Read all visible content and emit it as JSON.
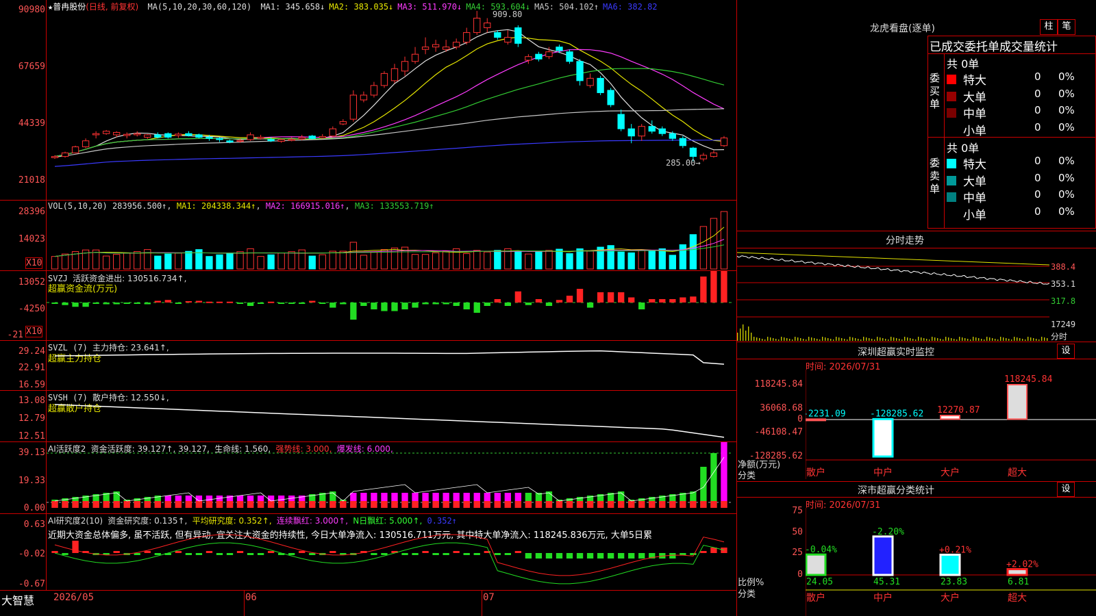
{
  "stock": {
    "star": "★",
    "name": "普冉股份",
    "mode": "(日线, 前复权)"
  },
  "price_ma": {
    "label": "MA(5,10,20,30,60,120)",
    "items": [
      {
        "text": "MA1: 345.658↓",
        "color": "#e0e0e0"
      },
      {
        "text": "MA2: 383.035↓",
        "color": "#e6e600"
      },
      {
        "text": "MA3: 511.970↓",
        "color": "#ff3cff"
      },
      {
        "text": "MA4: 593.604↓",
        "color": "#33cc33"
      },
      {
        "text": "MA5: 504.102↑",
        "color": "#c8c8c8"
      },
      {
        "text": "MA6: 382.82",
        "color": "#3a3aff"
      }
    ],
    "high_mark": "909.80",
    "low_mark": "285.00→"
  },
  "price_axis": [
    "90980",
    "67659",
    "44339",
    "21018"
  ],
  "vol": {
    "label": "VOL(5,10,20)",
    "value": "283956.500↑",
    "ma1": "MA1: 204338.344↑",
    "ma2": "MA2: 166915.016↑",
    "ma3": "MA3: 133553.719↑",
    "axis": [
      "28396",
      "14023"
    ],
    "unit": "X10"
  },
  "svzj": {
    "label": "SVZJ",
    "desc": "活跃资金进出: 130516.734↑,",
    "sub": "超赢资金流(万元)",
    "axis": [
      "13052",
      "-4250",
      "-21"
    ],
    "unit": "X10"
  },
  "svzl": {
    "label": "SVZL (7)",
    "desc": "主力持仓: 23.641↑,",
    "sub": "超赢主力持仓",
    "axis": [
      "29.24",
      "22.91",
      "16.59"
    ]
  },
  "svsh": {
    "label": "SVSH (7)",
    "desc": "散户持仓: 12.550↓,",
    "sub": "超赢散户持仓",
    "axis": [
      "13.08",
      "12.79",
      "12.51"
    ]
  },
  "ai1": {
    "label": "AI活跃度2",
    "desc": "资金活跃度: 39.127↑, 39.127,",
    "life": "生命线: 1.560,",
    "strong": "强势线: 3.000,",
    "burst": "爆发线: 6.000,",
    "axis": [
      "39.13",
      "19.33",
      "0.00"
    ]
  },
  "ai2": {
    "label": "AI研究度2(10)",
    "desc": "资金研究度: 0.135↑,",
    "avg": "平均研究度: 0.352↑,",
    "cont": "连续飘红: 3.000↑,",
    "nday": "N日飘红: 5.000↑,",
    "last": "0.352↑",
    "axis": [
      "0.63",
      "-0.02",
      "-0.67"
    ],
    "comment": "近期大资金总体偏多, 虽不活跃, 但有异动, 宜关注大资金的持续性, 今日大单净流入: 130516.711万元, 其中特大单净流入: 118245.836万元, 大单5日累"
  },
  "xaxis": {
    "brand": "大智慧",
    "d1": "2026/05",
    "d2": "06",
    "d3": "07"
  },
  "right": {
    "dragon_title": "龙虎看盘(逐单)",
    "btn_bar": "柱",
    "btn_pen": "笔",
    "stats_title": "已成交委托单成交量统计",
    "buy_label": "委买单",
    "sell_label": "委卖单",
    "total": "共 0单",
    "rows": [
      {
        "name": "特大",
        "val": "0",
        "pct": "0%",
        "buycolor": "#ff0000",
        "sellcolor": "#00ffff"
      },
      {
        "name": "大单",
        "val": "0",
        "pct": "0%",
        "buycolor": "#990000",
        "sellcolor": "#009999"
      },
      {
        "name": "中单",
        "val": "0",
        "pct": "0%",
        "buycolor": "#7a0000",
        "sellcolor": "#008080"
      },
      {
        "name": "小单",
        "val": "0",
        "pct": "0%",
        "buycolor": "#000000",
        "sellcolor": "#000000"
      }
    ],
    "minute_title": "分时走势",
    "minute_axis": [
      "388.4",
      "353.1",
      "317.8"
    ],
    "minute_vol": "17249",
    "minute_vol_unit": "分时",
    "sz_title": "深圳超赢实时监控",
    "set": "设",
    "sz_time": "时间: 2026/07/31",
    "sz_axis": [
      "118245.84",
      "36068.68",
      "0",
      "-46108.47",
      "-128285.62"
    ],
    "sz_ylabel": "净额(万元)",
    "sz_ylabel2": "分类",
    "sz_bars": [
      {
        "cat": "散户",
        "value": -2231.09,
        "label": "-2231.09"
      },
      {
        "cat": "中户",
        "value": -128285.62,
        "label": "-128285.62"
      },
      {
        "cat": "大户",
        "value": 12270.87,
        "label": "12270.87"
      },
      {
        "cat": "超大",
        "value": 118245.84,
        "label": "118245.84"
      }
    ],
    "ss_title": "深市超赢分类统计",
    "ss_time": "时间: 2026/07/31",
    "ss_axis": [
      "75",
      "50",
      "25",
      "0"
    ],
    "ss_ylabel": "比例%",
    "ss_ylabel2": "分类",
    "ss_bars": [
      {
        "cat": "散户",
        "value": 24.05,
        "change": "-0.04%"
      },
      {
        "cat": "中户",
        "value": 45.31,
        "change": "-2.20%"
      },
      {
        "cat": "大户",
        "value": 23.83,
        "change": "+0.21%"
      },
      {
        "cat": "超大",
        "value": 6.81,
        "change": "+2.02%"
      }
    ]
  },
  "chart_data": {
    "type": "candlestick",
    "title": "普冉股份",
    "candles": [
      {
        "o": 300,
        "c": 305,
        "h": 310,
        "l": 295
      },
      {
        "o": 305,
        "c": 320,
        "h": 325,
        "l": 300
      },
      {
        "o": 320,
        "c": 345,
        "h": 350,
        "l": 318
      },
      {
        "o": 345,
        "c": 370,
        "h": 380,
        "l": 340
      },
      {
        "o": 395,
        "c": 400,
        "h": 410,
        "l": 380
      },
      {
        "o": 400,
        "c": 410,
        "h": 415,
        "l": 395
      },
      {
        "o": 395,
        "c": 405,
        "h": 410,
        "l": 385
      },
      {
        "o": 392,
        "c": 397,
        "h": 405,
        "l": 380
      },
      {
        "o": 395,
        "c": 400,
        "h": 410,
        "l": 388
      },
      {
        "o": 385,
        "c": 395,
        "h": 398,
        "l": 378
      },
      {
        "o": 395,
        "c": 385,
        "h": 405,
        "l": 380
      },
      {
        "o": 400,
        "c": 385,
        "h": 405,
        "l": 380
      },
      {
        "o": 392,
        "c": 398,
        "h": 405,
        "l": 382
      },
      {
        "o": 400,
        "c": 392,
        "h": 410,
        "l": 388
      },
      {
        "o": 395,
        "c": 385,
        "h": 400,
        "l": 380
      },
      {
        "o": 385,
        "c": 380,
        "h": 395,
        "l": 370
      },
      {
        "o": 380,
        "c": 375,
        "h": 385,
        "l": 365
      },
      {
        "o": 370,
        "c": 365,
        "h": 375,
        "l": 360
      },
      {
        "o": 368,
        "c": 372,
        "h": 380,
        "l": 362
      },
      {
        "o": 375,
        "c": 395,
        "h": 405,
        "l": 370
      },
      {
        "o": 380,
        "c": 385,
        "h": 395,
        "l": 375
      },
      {
        "o": 375,
        "c": 370,
        "h": 385,
        "l": 365
      },
      {
        "o": 368,
        "c": 375,
        "h": 380,
        "l": 362
      },
      {
        "o": 372,
        "c": 376,
        "h": 385,
        "l": 368
      },
      {
        "o": 378,
        "c": 384,
        "h": 395,
        "l": 372
      },
      {
        "o": 390,
        "c": 380,
        "h": 395,
        "l": 375
      },
      {
        "o": 382,
        "c": 388,
        "h": 398,
        "l": 378
      },
      {
        "o": 390,
        "c": 420,
        "h": 430,
        "l": 385
      },
      {
        "o": 440,
        "c": 450,
        "h": 460,
        "l": 435
      },
      {
        "o": 460,
        "c": 560,
        "h": 580,
        "l": 450
      },
      {
        "o": 540,
        "c": 560,
        "h": 575,
        "l": 530
      },
      {
        "o": 560,
        "c": 600,
        "h": 615,
        "l": 550
      },
      {
        "o": 600,
        "c": 650,
        "h": 660,
        "l": 590
      },
      {
        "o": 620,
        "c": 670,
        "h": 690,
        "l": 610
      },
      {
        "o": 660,
        "c": 700,
        "h": 720,
        "l": 640
      },
      {
        "o": 700,
        "c": 730,
        "h": 760,
        "l": 690
      },
      {
        "o": 750,
        "c": 760,
        "h": 800,
        "l": 730
      },
      {
        "o": 760,
        "c": 770,
        "h": 790,
        "l": 740
      },
      {
        "o": 750,
        "c": 760,
        "h": 790,
        "l": 740
      },
      {
        "o": 760,
        "c": 780,
        "h": 795,
        "l": 750
      },
      {
        "o": 780,
        "c": 820,
        "h": 840,
        "l": 770
      },
      {
        "o": 820,
        "c": 880,
        "h": 909.8,
        "l": 810
      },
      {
        "o": 840,
        "c": 860,
        "h": 880,
        "l": 820
      },
      {
        "o": 820,
        "c": 800,
        "h": 830,
        "l": 790
      },
      {
        "o": 780,
        "c": 800,
        "h": 830,
        "l": 770
      },
      {
        "o": 840,
        "c": 775,
        "h": 850,
        "l": 760
      },
      {
        "o": 705,
        "c": 720,
        "h": 730,
        "l": 690
      },
      {
        "o": 730,
        "c": 710,
        "h": 740,
        "l": 700
      },
      {
        "o": 720,
        "c": 740,
        "h": 760,
        "l": 710
      },
      {
        "o": 760,
        "c": 745,
        "h": 770,
        "l": 735
      },
      {
        "o": 740,
        "c": 700,
        "h": 750,
        "l": 690
      },
      {
        "o": 700,
        "c": 620,
        "h": 710,
        "l": 600
      },
      {
        "o": 600,
        "c": 630,
        "h": 650,
        "l": 590
      },
      {
        "o": 630,
        "c": 570,
        "h": 640,
        "l": 560
      },
      {
        "o": 580,
        "c": 520,
        "h": 590,
        "l": 510
      },
      {
        "o": 480,
        "c": 420,
        "h": 500,
        "l": 410
      },
      {
        "o": 420,
        "c": 390,
        "h": 440,
        "l": 360
      },
      {
        "o": 390,
        "c": 430,
        "h": 440,
        "l": 370
      },
      {
        "o": 430,
        "c": 410,
        "h": 455,
        "l": 400
      },
      {
        "o": 420,
        "c": 400,
        "h": 430,
        "l": 390
      },
      {
        "o": 400,
        "c": 380,
        "h": 410,
        "l": 370
      },
      {
        "o": 380,
        "c": 350,
        "h": 390,
        "l": 340
      },
      {
        "o": 340,
        "c": 305,
        "h": 345,
        "l": 285
      },
      {
        "o": 295,
        "c": 310,
        "h": 320,
        "l": 285
      },
      {
        "o": 305,
        "c": 320,
        "h": 330,
        "l": 300
      },
      {
        "o": 350,
        "c": 382,
        "h": 390,
        "l": 345
      }
    ]
  }
}
